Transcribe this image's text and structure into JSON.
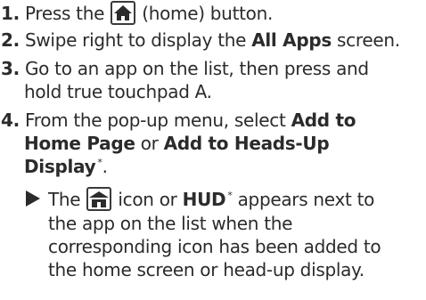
{
  "steps": [
    {
      "number": "1.",
      "before_icon": "Press the ",
      "icon": "home-icon",
      "after_icon": " (home) button."
    },
    {
      "number": "2.",
      "text_a": "Swipe right to display the ",
      "text_bold": "All Apps",
      "text_b": " screen."
    },
    {
      "number": "3.",
      "line1": "Go to an app on the list, then press and",
      "line2": "hold true touchpad A."
    },
    {
      "number": "4.",
      "text_a": "From the pop-up menu, select ",
      "bold_1a": "Add to",
      "bold_1b": "Home Page",
      "text_or": " or ",
      "bold_2a": "Add to Heads-Up",
      "bold_2b": "Display",
      "footnote_mark": "*",
      "period": "."
    }
  ],
  "note": {
    "bullet_icon": "triangle-arrow-icon",
    "text_a": "The ",
    "icon": "home-icon",
    "text_b": " icon or ",
    "hud_label": "HUD",
    "footnote_mark": "*",
    "text_c": " appears next to",
    "line2": "the app on the list when the",
    "line3": "corresponding icon has been added to",
    "line4": "the home screen or head-up display."
  }
}
